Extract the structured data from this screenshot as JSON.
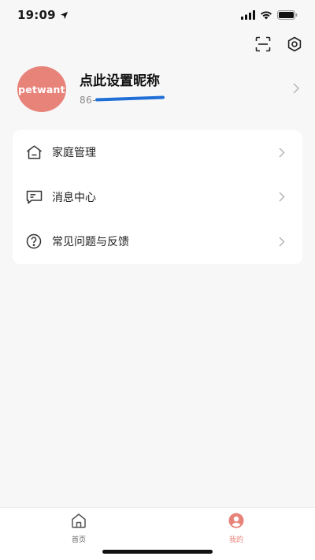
{
  "status_bar": {
    "time": "19:09",
    "location_icon": "location-arrow-icon",
    "signal_icon": "cellular-signal-icon",
    "wifi_icon": "wifi-icon",
    "battery_icon": "battery-icon"
  },
  "top_actions": {
    "scan_icon": "scan-icon",
    "settings_icon": "settings-icon"
  },
  "profile": {
    "avatar_text": "petwant",
    "nickname": "点此设置昵称",
    "phone": "86-",
    "avatar_color": "#e8837a"
  },
  "menu": {
    "items": [
      {
        "label": "家庭管理",
        "icon": "home-outline-icon"
      },
      {
        "label": "消息中心",
        "icon": "message-icon"
      },
      {
        "label": "常见问题与反馈",
        "icon": "help-circle-icon"
      }
    ]
  },
  "tabs": [
    {
      "label": "首页",
      "icon": "home-tab-icon",
      "active": false
    },
    {
      "label": "我的",
      "icon": "profile-tab-icon",
      "active": true
    }
  ],
  "colors": {
    "accent": "#e8837a",
    "background": "#f7f7f7",
    "card": "#ffffff",
    "redaction": "#1f6fd6"
  }
}
